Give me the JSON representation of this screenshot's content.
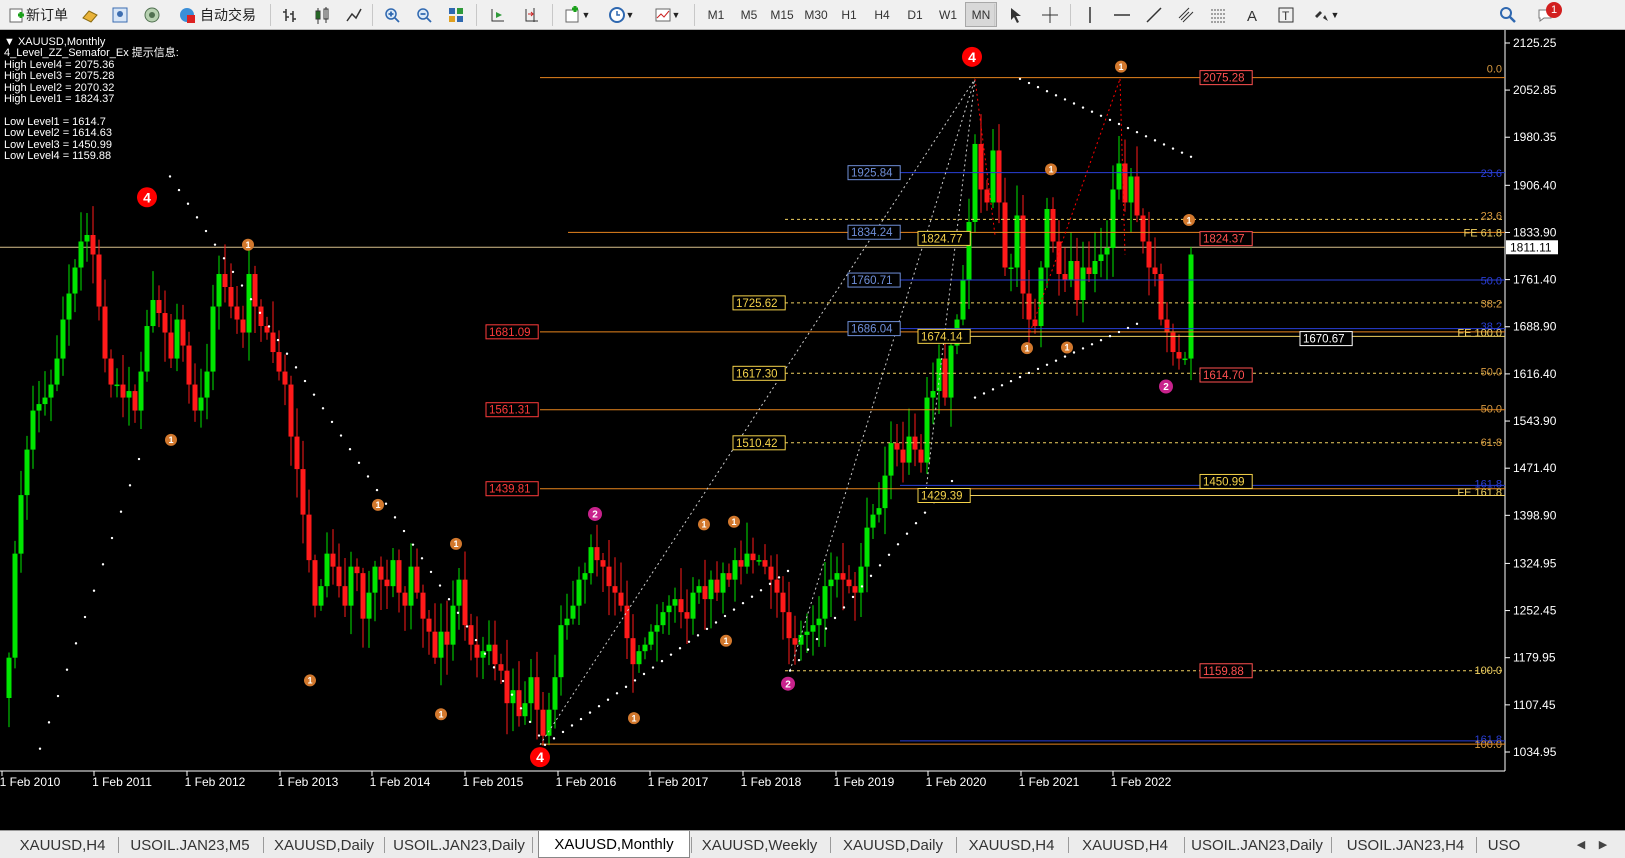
{
  "toolbar": {
    "new_order": "新订单",
    "auto_trading": "自动交易",
    "timeframes": [
      "M1",
      "M5",
      "M15",
      "M30",
      "H1",
      "H4",
      "D1",
      "W1",
      "MN"
    ],
    "active_timeframe": "MN"
  },
  "chart": {
    "symbol_line": "XAUUSD,Monthly",
    "indicator_title": "4_Level_ZZ_Semafor_Ex 提示信息:",
    "high_levels": [
      "High Level4 = 2075.36",
      "High Level3 = 2075.28",
      "High Level2 = 2070.32",
      "High Level1 = 1824.37"
    ],
    "low_levels": [
      "Low Level1 = 1614.7",
      "Low Level2 = 1614.63",
      "Low Level3 = 1450.99",
      "Low Level4 = 1159.88"
    ],
    "current_price": "1811.11",
    "price_axis": [
      "2125.25",
      "2052.85",
      "1980.35",
      "1906.40",
      "1833.90",
      "1761.40",
      "1688.90",
      "1616.40",
      "1543.90",
      "1471.40",
      "1398.90",
      "1324.95",
      "1252.45",
      "1179.95",
      "1107.45",
      "1034.95"
    ],
    "time_axis": [
      "1 Feb 2010",
      "1 Feb 2011",
      "1 Feb 2012",
      "1 Feb 2013",
      "1 Feb 2014",
      "1 Feb 2015",
      "1 Feb 2016",
      "1 Feb 2017",
      "1 Feb 2018",
      "1 Feb 2019",
      "1 Feb 2020",
      "1 Feb 2021",
      "1 Feb 2022"
    ],
    "boxed_labels_red": [
      "1681.09",
      "1561.31",
      "1439.81"
    ],
    "boxed_labels_yellow": [
      "1725.62",
      "1617.30",
      "1510.42",
      "1824.77",
      "1674.14",
      "1429.39",
      "1450.99"
    ],
    "boxed_labels_blue": [
      "1925.84",
      "1834.24",
      "1760.71",
      "1686.04"
    ],
    "boxed_labels_pink": [
      "2075.28",
      "1824.37",
      "1614.70",
      "1159.88"
    ],
    "boxed_label_white": "1670.67",
    "fib_labels_right": [
      "0.0",
      "23.6",
      "23.6",
      "FE 61.8",
      "50.0",
      "38.2",
      "38.2",
      "FE 100.0",
      "50.0",
      "50.0",
      "61.8",
      "161.8",
      "FE 161.8",
      "100.0",
      "161.8",
      "100.0"
    ],
    "semafor_marks": [
      "4",
      "4",
      "4",
      "1",
      "2"
    ]
  },
  "tabs": [
    "XAUUSD,H4",
    "USOIL.JAN23,M5",
    "XAUUSD,Daily",
    "USOIL.JAN23,Daily",
    "XAUUSD,Monthly",
    "XAUUSD,Weekly",
    "XAUUSD,Daily",
    "XAUUSD,H4",
    "XAUUSD,H4",
    "USOIL.JAN23,Daily",
    "USOIL.JAN23,H4",
    "USO"
  ],
  "active_tab": "XAUUSD,Monthly",
  "notification_count": "1",
  "colors": {
    "bull": "#00e600",
    "bear": "#ff1a1a",
    "fib_orange": "#e8851e",
    "fib_blue": "#2a3fd8",
    "semafor_red": "#ff0000",
    "semafor_orange": "#d2782d",
    "semafor_pink": "#c8228c"
  }
}
